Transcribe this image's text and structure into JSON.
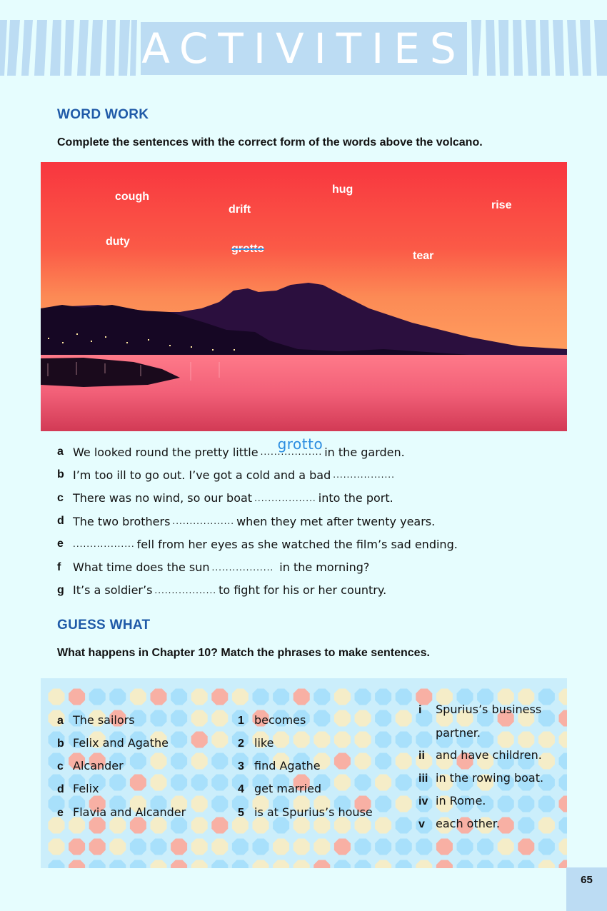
{
  "banner": {
    "title": "ACTIVITIES"
  },
  "word_work": {
    "heading": "WORD WORK",
    "instruction": "Complete the sentences with the correct form of the words above the volcano.",
    "words": [
      "cough",
      "hug",
      "drift",
      "rise",
      "duty",
      "grotto",
      "tear"
    ],
    "sentences": [
      {
        "letter": "a",
        "before": "We looked round the pretty little",
        "after": "in the garden.",
        "answer": "grotto"
      },
      {
        "letter": "b",
        "before": "I’m too ill to go out. I’ve got a cold and a bad",
        "after": ""
      },
      {
        "letter": "c",
        "before": "There was no wind, so our boat",
        "after": "into the port."
      },
      {
        "letter": "d",
        "before": "The two brothers",
        "after": "when they met after twenty years."
      },
      {
        "letter": "e",
        "before": "",
        "after": "fell from her eyes as she watched the film’s sad ending."
      },
      {
        "letter": "f",
        "before": "What time does the sun",
        "after": " in the morning?"
      },
      {
        "letter": "g",
        "before": "It’s a soldier’s",
        "after": "to fight for his or her country."
      }
    ]
  },
  "guess_what": {
    "heading": "GUESS WHAT",
    "instruction": "What happens in Chapter 10? Match the phrases to make sentences.",
    "col1": [
      {
        "key": "a",
        "text": "The sailors"
      },
      {
        "key": "b",
        "text": "Felix and Agathe"
      },
      {
        "key": "c",
        "text": "Alcander"
      },
      {
        "key": "d",
        "text": "Felix"
      },
      {
        "key": "e",
        "text": "Flavia and Alcander"
      }
    ],
    "col2": [
      {
        "key": "1",
        "text": "becomes"
      },
      {
        "key": "2",
        "text": "like"
      },
      {
        "key": "3",
        "text": "find Agathe"
      },
      {
        "key": "4",
        "text": "get married"
      },
      {
        "key": "5",
        "text": "is at Spurius’s house"
      }
    ],
    "col3": [
      {
        "key": "i",
        "text": "Spurius’s business",
        "cont": "partner."
      },
      {
        "key": "ii",
        "text": "and have children."
      },
      {
        "key": "iii",
        "text": "in the rowing boat."
      },
      {
        "key": "iv",
        "text": "in Rome."
      },
      {
        "key": "v",
        "text": "each other."
      }
    ]
  },
  "page_number": "65",
  "colors": {
    "heading": "#1f5aa8",
    "banner": "#bcdcf3",
    "answer_ink": "#2c8de0",
    "page_bg": "#e6fdfe"
  }
}
